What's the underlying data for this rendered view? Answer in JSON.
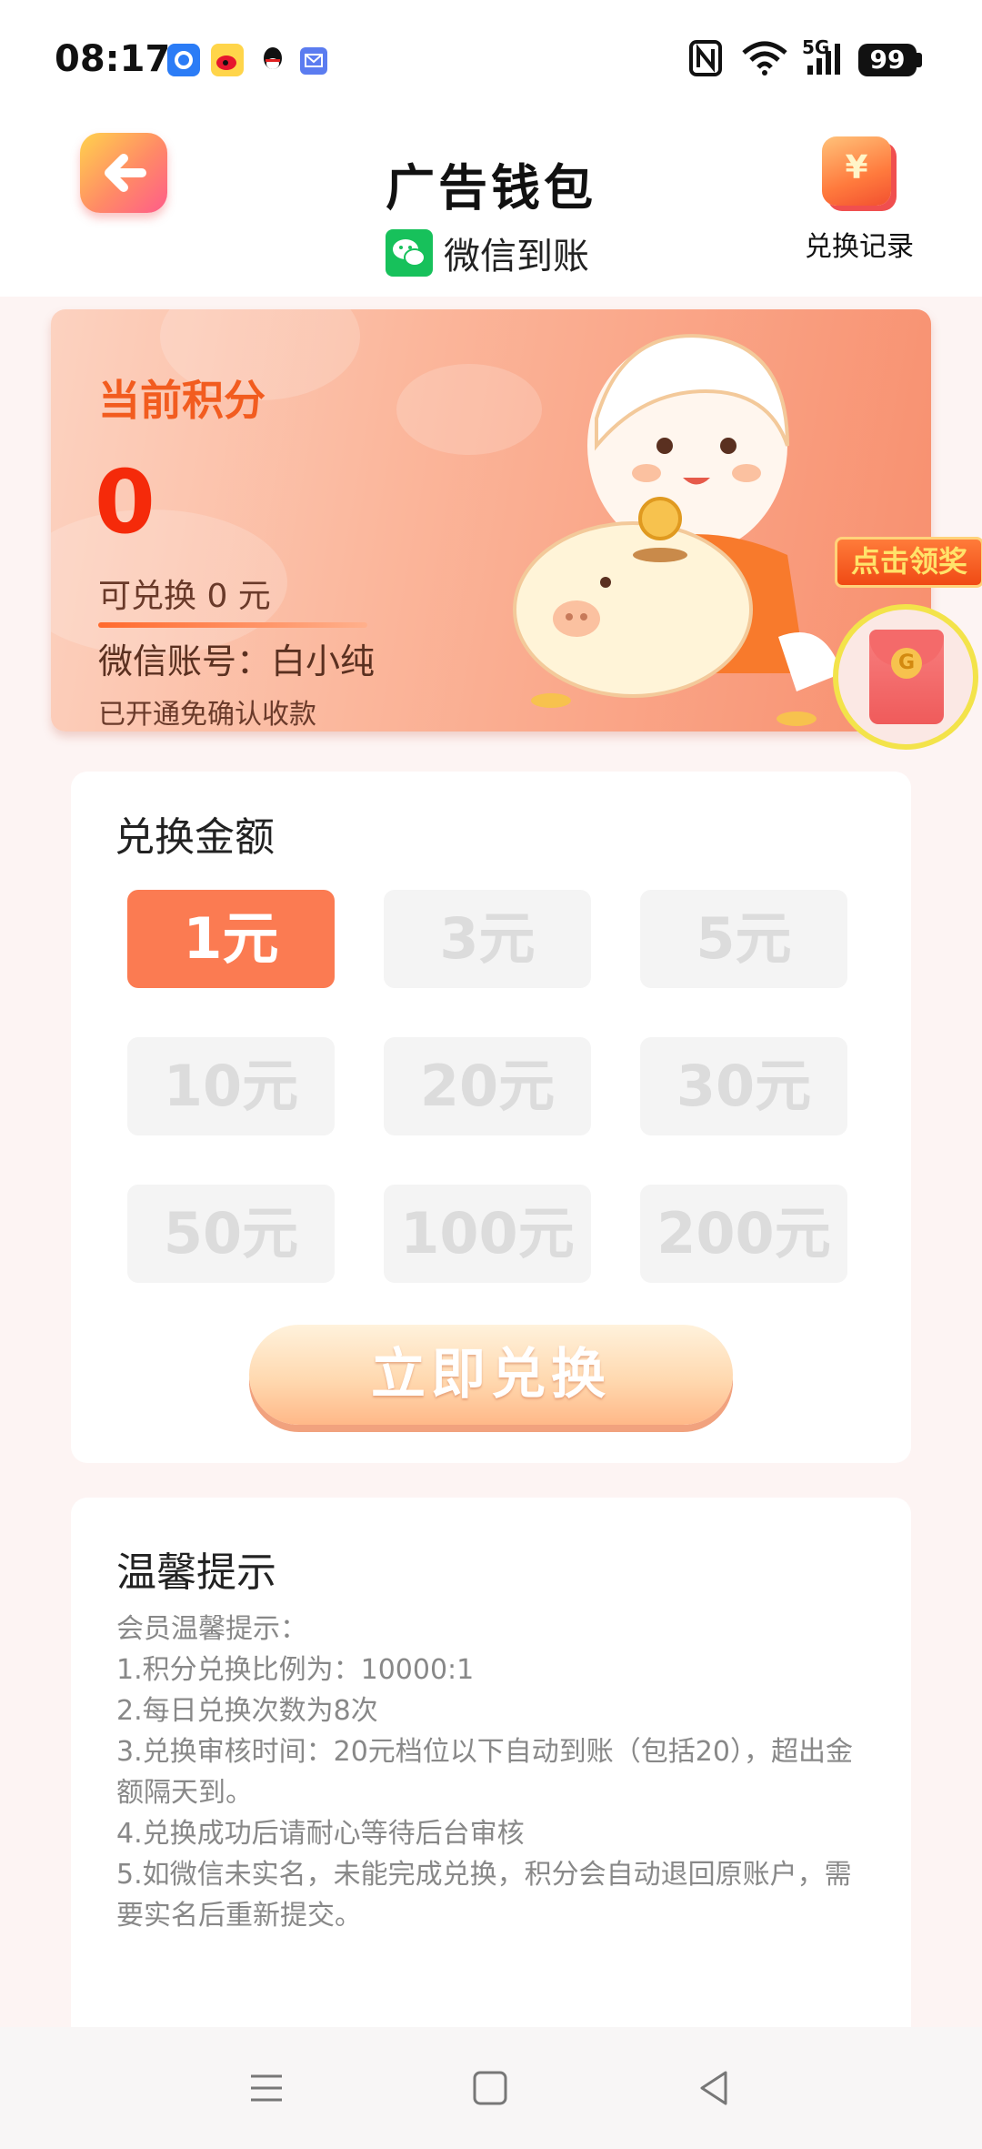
{
  "status_bar": {
    "time": "08:17",
    "battery": "99",
    "network": "5G",
    "nfc": "N"
  },
  "header": {
    "title": "广告钱包",
    "subtitle": "微信到账",
    "record_label": "兑换记录",
    "record_icon_glyph": "¥"
  },
  "points_card": {
    "title": "当前积分",
    "value": "0",
    "redeemable": "可兑换 0 元",
    "account": "微信账号：白小纯",
    "auth_status": "已开通免确认收款"
  },
  "float_claim": {
    "label": "点击领奖",
    "coin_glyph": "G"
  },
  "exchange": {
    "title": "兑换金额",
    "amounts": [
      "1元",
      "3元",
      "5元",
      "10元",
      "20元",
      "30元",
      "50元",
      "100元",
      "200元"
    ],
    "selected": "1元",
    "button": "立即兑换"
  },
  "tips": {
    "title": "温馨提示",
    "lines": [
      "会员温馨提示：",
      "1.积分兑换比例为：10000:1",
      "2.每日兑换次数为8次",
      "3.兑换审核时间：20元档位以下自动到账（包括20），超出金额隔天到。",
      "4.兑换成功后请耐心等待后台审核",
      "5.如微信未实名，未能完成兑换，积分会自动退回原账户，需要实名后重新提交。"
    ]
  },
  "colors": {
    "accent": "#fb7b52",
    "points_value": "#f52a0a",
    "points_title": "#f25c1f",
    "wechat_green": "#17c15b"
  }
}
